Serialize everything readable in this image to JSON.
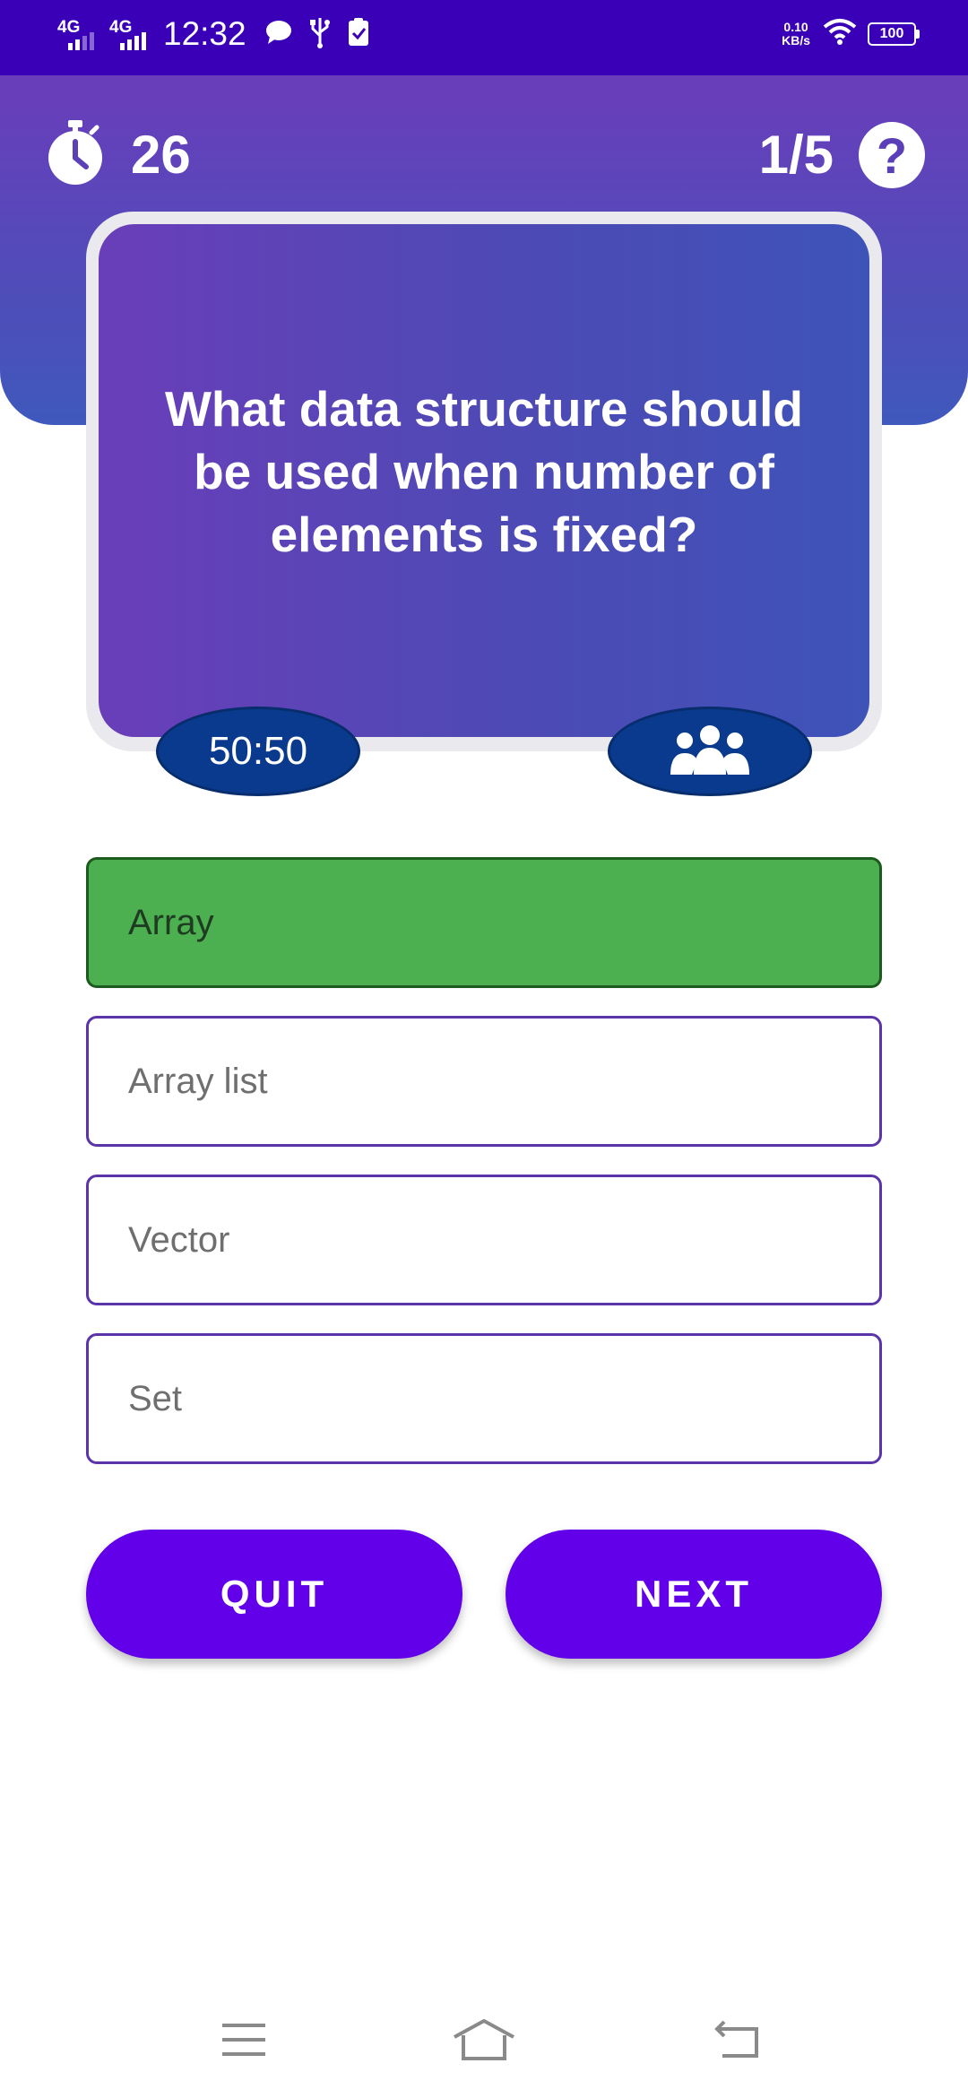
{
  "status_bar": {
    "net1": "4G",
    "net2": "4G",
    "time": "12:32",
    "speed_value": "0.10",
    "speed_unit": "KB/s",
    "battery": "100",
    "icons": [
      "chat-icon",
      "usb-icon",
      "clipboard-check-icon",
      "wifi-icon"
    ]
  },
  "header": {
    "timer_seconds": "26",
    "progress": "1/5",
    "help_symbol": "?"
  },
  "question": {
    "text": "What data structure should be used when number of elements is fixed?"
  },
  "lifelines": {
    "fifty_fifty_label": "50:50",
    "audience_icon": "people-group-icon"
  },
  "answers": [
    {
      "label": "Array",
      "state": "correct"
    },
    {
      "label": "Array list",
      "state": "default"
    },
    {
      "label": "Vector",
      "state": "default"
    },
    {
      "label": "Set",
      "state": "default"
    }
  ],
  "buttons": {
    "quit_label": "QUIT",
    "next_label": "NEXT"
  },
  "colors": {
    "status_bar": "#3a00b8",
    "header_top": "#6a3dbb",
    "header_bottom": "#3f59bd",
    "correct": "#4caf50",
    "button": "#6200ea",
    "lifeline": "#0a3a8e"
  },
  "nav_bar": {
    "icons": [
      "menu-icon",
      "home-icon",
      "back-icon"
    ]
  }
}
